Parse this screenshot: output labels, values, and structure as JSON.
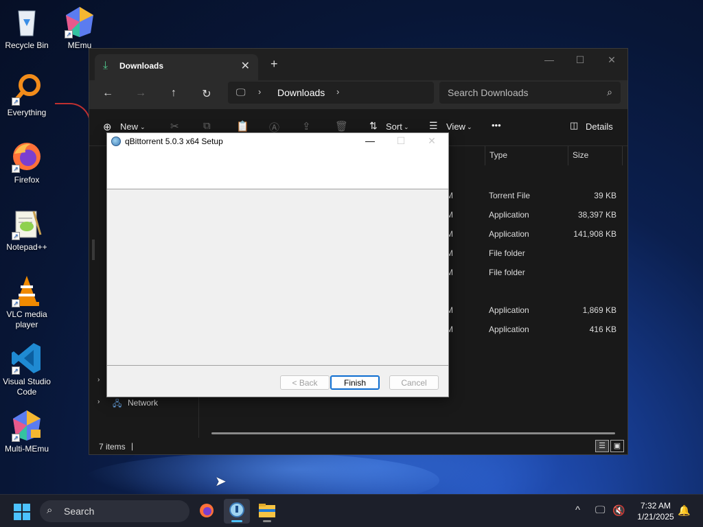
{
  "desktop": {
    "icons": [
      {
        "label": "Recycle Bin"
      },
      {
        "label": "MEmu"
      },
      {
        "label": "Everything"
      },
      {
        "label": "Firefox"
      },
      {
        "label": "Notepad++"
      },
      {
        "label": "VLC media player"
      },
      {
        "label": "Visual Studio Code"
      },
      {
        "label": "Multi-MEmu"
      }
    ]
  },
  "explorer": {
    "tab_title": "Downloads",
    "breadcrumb": "Downloads",
    "search_placeholder": "Search Downloads",
    "toolbar": {
      "new_label": "New",
      "sort_label": "Sort",
      "view_label": "View",
      "more_label": "•••",
      "details_label": "Details"
    },
    "columns": {
      "type": "Type",
      "size": "Size"
    },
    "files": [
      {
        "time": "M",
        "type": "Torrent File",
        "size": "39 KB"
      },
      {
        "time": "M",
        "type": "Application",
        "size": "38,397 KB"
      },
      {
        "time": "M",
        "type": "Application",
        "size": "141,908 KB"
      },
      {
        "time": "M",
        "type": "File folder",
        "size": ""
      },
      {
        "time": "M",
        "type": "File folder",
        "size": ""
      },
      {
        "time": "M",
        "type": "Application",
        "size": "1,869 KB"
      },
      {
        "time": "M",
        "type": "Application",
        "size": "416 KB"
      }
    ],
    "sidebar": {
      "network_label": "Network"
    },
    "status": {
      "item_count": "7 items",
      "caret": "|"
    }
  },
  "setup_dialog": {
    "title": "qBittorrent 5.0.3 x64 Setup",
    "back_label": "< Back",
    "finish_label": "Finish",
    "cancel_label": "Cancel"
  },
  "taskbar": {
    "search_label": "Search",
    "time": "7:32 AM",
    "date": "1/21/2025"
  }
}
